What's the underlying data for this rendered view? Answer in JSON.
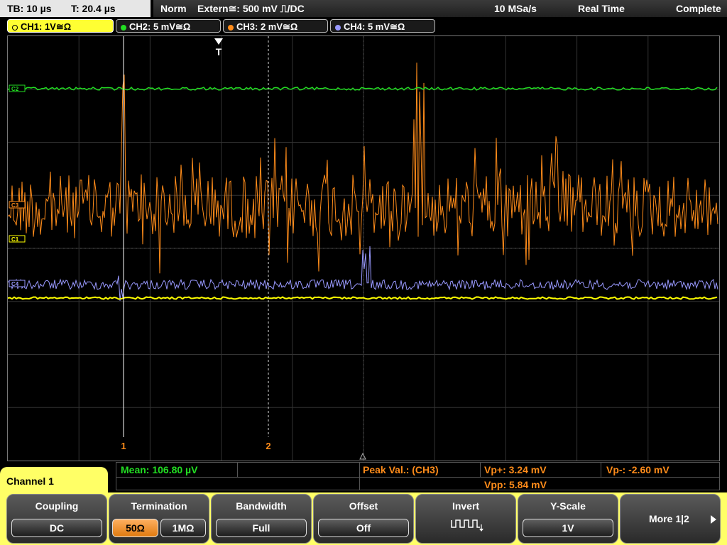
{
  "timebase": {
    "tb": "TB: 10 µs",
    "t": "T: 20.4 µs"
  },
  "status": {
    "mode": "Norm",
    "trigger": "Extern≅: 500 mV ⎍/DC",
    "sample_rate": "10 MSa/s",
    "acq_mode": "Real Time",
    "state": "Complete"
  },
  "channels": [
    {
      "label": "CH1: 1V≅Ω",
      "color": "#ffff00",
      "active": true
    },
    {
      "label": "CH2: 5 mV≅Ω",
      "color": "#22dd22",
      "active": false
    },
    {
      "label": "CH3: 2 mV≅Ω",
      "color": "#ff8c1a",
      "active": false
    },
    {
      "label": "CH4: 5 mV≅Ω",
      "color": "#9999ff",
      "active": false
    }
  ],
  "screen": {
    "trigger_marker": "T",
    "cursor1_label": "1",
    "cursor2_label": "2",
    "ch_markers": {
      "ch1": "C1",
      "ch2": "C2",
      "ch3": "C3",
      "ch4": "C4"
    }
  },
  "measurements": {
    "mean": "Mean: 106.80 µV",
    "peak": "Peak Val.:  (CH3)",
    "vp_plus": "Vp+: 3.24 mV",
    "vp_minus": "Vp-: -2.60 mV",
    "vpp": "Vpp: 5.84 mV"
  },
  "menu": {
    "title": "Channel 1",
    "coupling": {
      "title": "Coupling",
      "value": "DC"
    },
    "termination": {
      "title": "Termination",
      "opt1": "50Ω",
      "opt2": "1MΩ"
    },
    "bandwidth": {
      "title": "Bandwidth",
      "value": "Full"
    },
    "offset": {
      "title": "Offset",
      "value": "Off"
    },
    "invert": {
      "title": "Invert",
      "icon": "square-wave-icon"
    },
    "yscale": {
      "title": "Y-Scale",
      "value": "1V"
    },
    "more": {
      "label": "More 1|2"
    }
  }
}
